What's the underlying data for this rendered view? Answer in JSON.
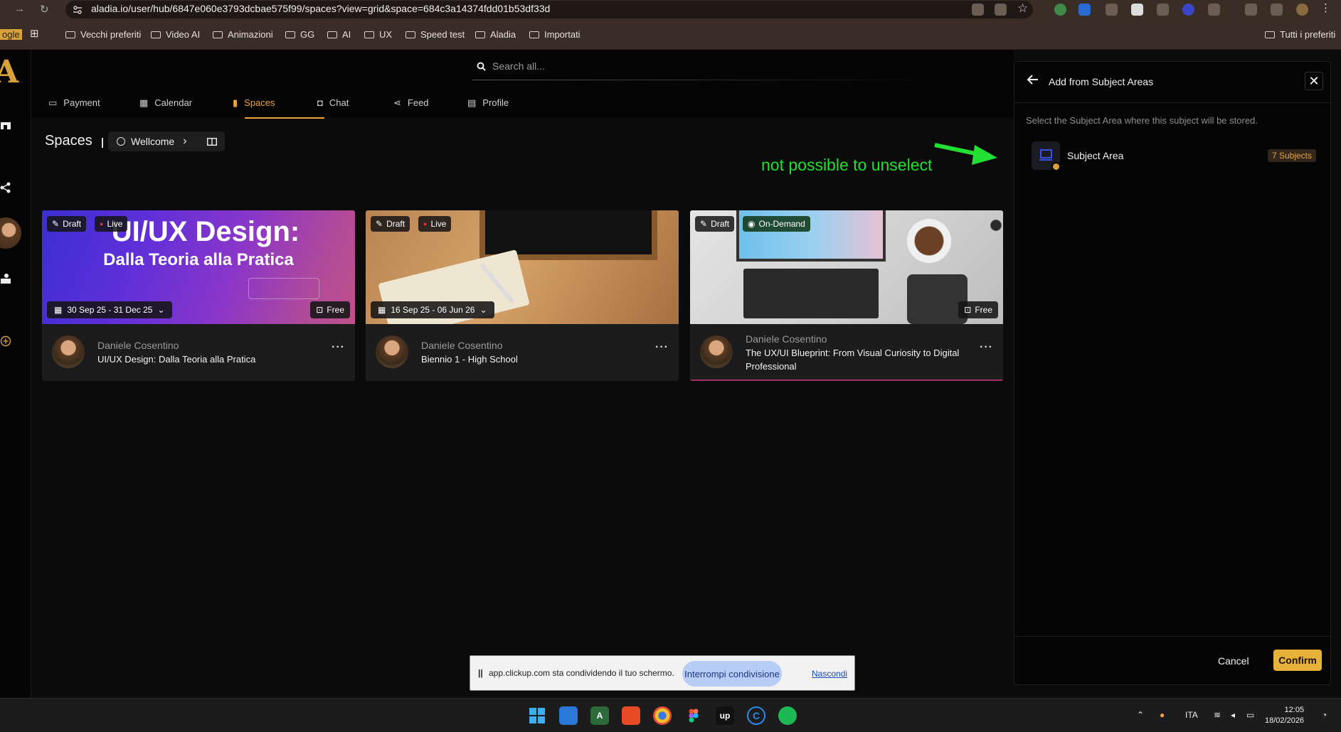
{
  "browser": {
    "url": "aladia.io/user/hub/6847e060e3793dcbae575f99/spaces?view=grid&space=684c3a14374fdd01b53df33d",
    "bookmarks": [
      "Vecchi preferiti",
      "Video AI",
      "Animazioni",
      "GG",
      "AI",
      "UX",
      "Speed test",
      "Aladia",
      "Importati"
    ],
    "bookmark_partial": "ogle",
    "all_bookmarks": "Tutti i preferiti"
  },
  "app": {
    "logo": "A",
    "search_placeholder": "Search all...",
    "tabs": [
      {
        "label": "Payment",
        "icon": "card-icon"
      },
      {
        "label": "Calendar",
        "icon": "calendar-icon"
      },
      {
        "label": "Spaces",
        "icon": "spaces-icon",
        "active": true
      },
      {
        "label": "Chat",
        "icon": "chat-icon"
      },
      {
        "label": "Feed",
        "icon": "share-icon"
      },
      {
        "label": "Profile",
        "icon": "profile-icon"
      }
    ],
    "page_title": "Spaces",
    "breadcrumb": "Wellcome",
    "annotation": "not possible to unselect"
  },
  "cards": [
    {
      "badges": [
        "Draft",
        "Live"
      ],
      "banner_line1": "UI/UX Design:",
      "banner_line2": "Dalla Teoria alla Pratica",
      "date": "30 Sep 25 - 31 Dec 25",
      "price": "Free",
      "author": "Daniele Cosentino",
      "title": "UI/UX Design: Dalla Teoria alla Pratica"
    },
    {
      "badges": [
        "Draft",
        "Live"
      ],
      "date": "16 Sep 25 - 06 Jun 26",
      "price": "",
      "author": "Daniele Cosentino",
      "title": "Biennio 1 - High School"
    },
    {
      "badges": [
        "Draft",
        "On-Demand"
      ],
      "date": "",
      "price": "Free",
      "author": "Daniele Cosentino",
      "title": "The UX/UI Blueprint: From Visual Curiosity to Digital Professional"
    }
  ],
  "panel": {
    "title": "Add from Subject Areas",
    "description": "Select the Subject Area where this subject will be stored.",
    "subject_label": "Subject Area",
    "subject_count": "7 Subjects",
    "cancel": "Cancel",
    "confirm": "Confirm"
  },
  "sharebar": {
    "text": "app.clickup.com sta condividendo il tuo schermo.",
    "stop": "Interrompi condivisione",
    "hide": "Nascondi"
  },
  "taskbar": {
    "lang": "ITA",
    "time": "12:05",
    "date": "18/02/2026"
  },
  "colors": {
    "accent": "#e8a33a",
    "annotation": "#22e031"
  }
}
